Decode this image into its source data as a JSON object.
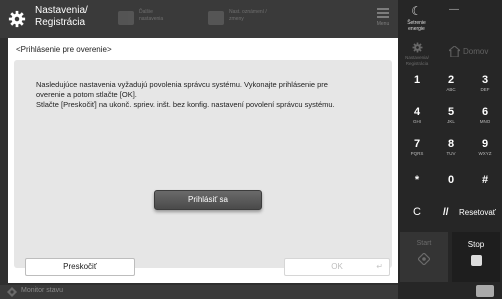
{
  "header": {
    "title": "Nastavenia/\nRegistrácia",
    "shortcut1": "Ďalšie\nnastavenia",
    "shortcut2": "Nast. oznámení /\nzmeny",
    "menu": "Menu"
  },
  "main": {
    "heading": "<Prihlásenie pre overenie>",
    "message": [
      "Nasledujúce nastavenia vyžadujú povolenia správcu systému. Vykonajte prihlásenie pre",
      "overenie a potom stlačte [OK].",
      "Stlačte [Preskočiť] na ukonč. spriev. inšt. bez konfig. nastavení povolení správcu systému."
    ],
    "login_button": "Prihlásiť sa",
    "skip_button": "Preskočiť",
    "ok_button": "OK"
  },
  "status": {
    "monitor": "Monitor stavu"
  },
  "right_panel": {
    "energy": "Šetrenie\nenergie",
    "dash": "—",
    "settings": "Nastavenia/\nRegistrácia",
    "home": "Domov",
    "keys": [
      {
        "main": "1",
        "sub": ""
      },
      {
        "main": "2",
        "sub": "ABC"
      },
      {
        "main": "3",
        "sub": "DEF"
      },
      {
        "main": "4",
        "sub": "GHI"
      },
      {
        "main": "5",
        "sub": "JKL"
      },
      {
        "main": "6",
        "sub": "MNO"
      },
      {
        "main": "7",
        "sub": "PQRS"
      },
      {
        "main": "8",
        "sub": "TUV"
      },
      {
        "main": "9",
        "sub": "WXYZ"
      },
      {
        "main": "*",
        "sub": ""
      },
      {
        "main": "0",
        "sub": ""
      },
      {
        "main": "#",
        "sub": ""
      },
      {
        "main": "C",
        "sub": ""
      }
    ],
    "reset": "Resetovať",
    "start": "Start",
    "stop": "Stop"
  },
  "colors": {
    "panel_dark": "#262626",
    "topbar": "#3a3a3a",
    "dialog_bg": "#e6e6e6"
  }
}
